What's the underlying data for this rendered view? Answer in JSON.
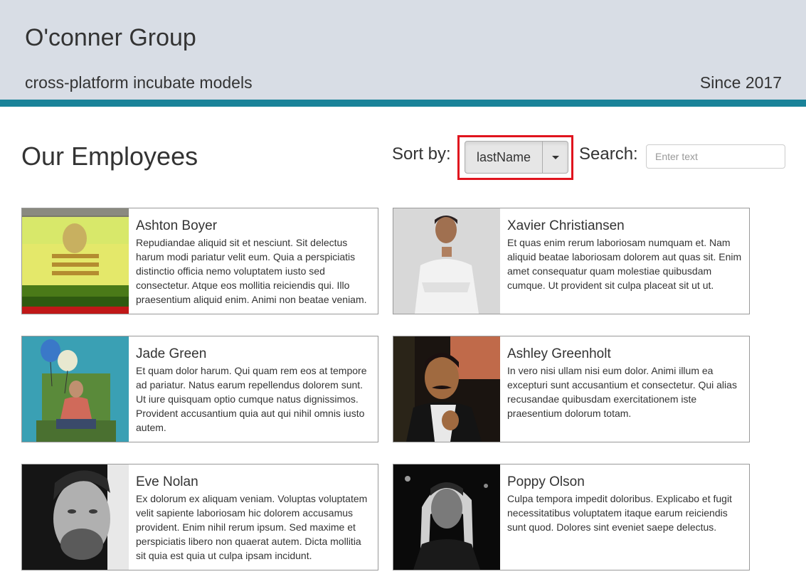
{
  "header": {
    "company": "O'conner Group",
    "tagline": "cross-platform incubate models",
    "since": "Since 2017",
    "accent_color": "#1a8399",
    "background_color": "#d8dde5"
  },
  "main": {
    "title": "Our Employees",
    "sort_label": "Sort by:",
    "sort_value": "lastName",
    "search_label": "Search:",
    "search_placeholder": "Enter text",
    "search_value": "",
    "highlight_color": "#e0141e"
  },
  "employees": [
    {
      "name": "Ashton Boyer",
      "bio": "Repudiandae aliquid sit et nesciunt. Sit delectus harum modi pariatur velit eum. Quia a perspiciatis distinctio officia nemo voluptatem iusto sed consectetur. Atque eos mollitia reiciendis qui. Illo praesentium aliquid enim. Animi non beatae veniam.",
      "photo": "person-photo-icon"
    },
    {
      "name": "Xavier Christiansen",
      "bio": "Et quas enim rerum laboriosam numquam et. Nam aliquid beatae laboriosam dolorem aut quas sit. Enim amet consequatur quam molestiae quibusdam cumque. Ut provident sit culpa placeat sit ut ut.",
      "photo": "person-photo-icon"
    },
    {
      "name": "Jade Green",
      "bio": "Et quam dolor harum. Qui quam rem eos at tempore ad pariatur. Natus earum repellendus dolorem sunt. Ut iure quisquam optio cumque natus dignissimos. Provident accusantium quia aut qui nihil omnis iusto autem.",
      "photo": "person-photo-icon"
    },
    {
      "name": "Ashley Greenholt",
      "bio": "In vero nisi ullam nisi eum dolor. Animi illum ea excepturi sunt accusantium et consectetur. Qui alias recusandae quibusdam exercitationem iste praesentium dolorum totam.",
      "photo": "person-photo-icon"
    },
    {
      "name": "Eve Nolan",
      "bio": "Ex dolorum ex aliquam veniam. Voluptas voluptatem velit sapiente laboriosam hic dolorem accusamus provident. Enim nihil rerum ipsum. Sed maxime et perspiciatis libero non quaerat autem. Dicta mollitia sit quia est quia ut culpa ipsam incidunt.",
      "photo": "person-photo-icon"
    },
    {
      "name": "Poppy Olson",
      "bio": "Culpa tempora impedit doloribus. Explicabo et fugit necessitatibus voluptatem itaque earum reiciendis sunt quod. Dolores sint eveniet saepe delectus.",
      "photo": "person-photo-icon"
    }
  ]
}
